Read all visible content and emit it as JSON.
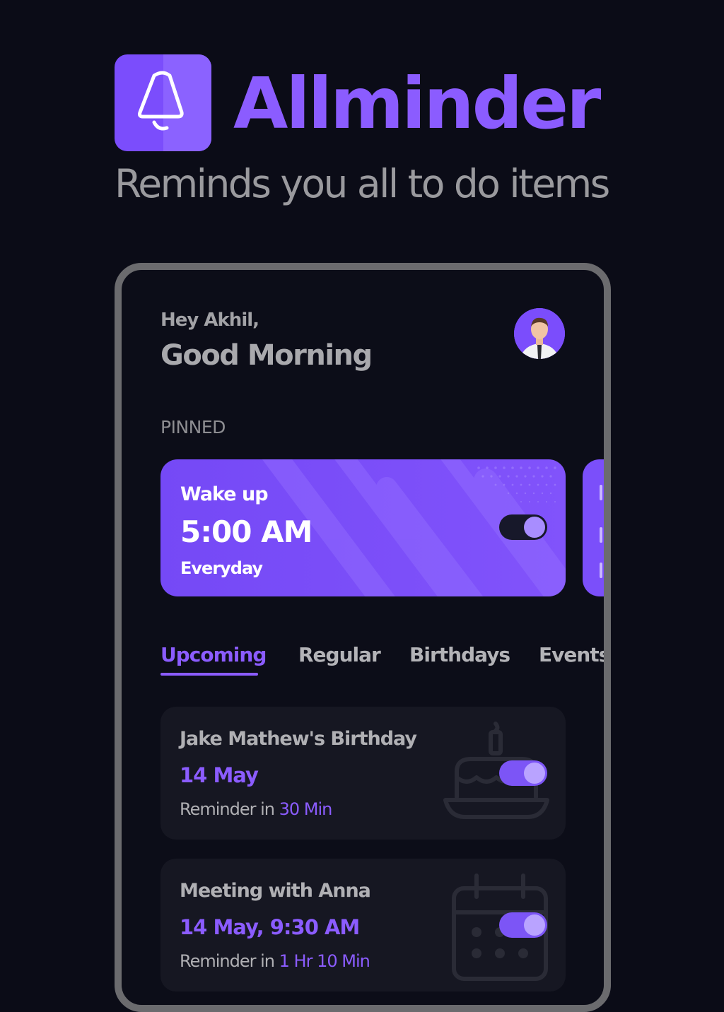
{
  "brand": {
    "name": "Allminder",
    "tagline": "Reminds you all to do items",
    "logo_icon": "bell-icon",
    "accent": "#8b5cff"
  },
  "greeting": {
    "small": "Hey Akhil,",
    "big": "Good Morning"
  },
  "pinned": {
    "label": "PINNED",
    "card": {
      "title": "Wake up",
      "time": "5:00 AM",
      "repeat": "Everyday",
      "enabled": true
    }
  },
  "tabs": [
    {
      "label": "Upcoming",
      "active": true
    },
    {
      "label": "Regular",
      "active": false
    },
    {
      "label": "Birthdays",
      "active": false
    },
    {
      "label": "Events",
      "active": false
    }
  ],
  "reminders": [
    {
      "title": "Jake Mathew's Birthday",
      "date": "14 May",
      "reminder_prefix": "Reminder in",
      "reminder_value": "30 Min",
      "enabled": true,
      "icon": "cake-icon"
    },
    {
      "title": "Meeting with Anna",
      "date": "14 May, 9:30 AM",
      "reminder_prefix": "Reminder in",
      "reminder_value": "1 Hr 10 Min",
      "enabled": true,
      "icon": "calendar-icon"
    }
  ]
}
